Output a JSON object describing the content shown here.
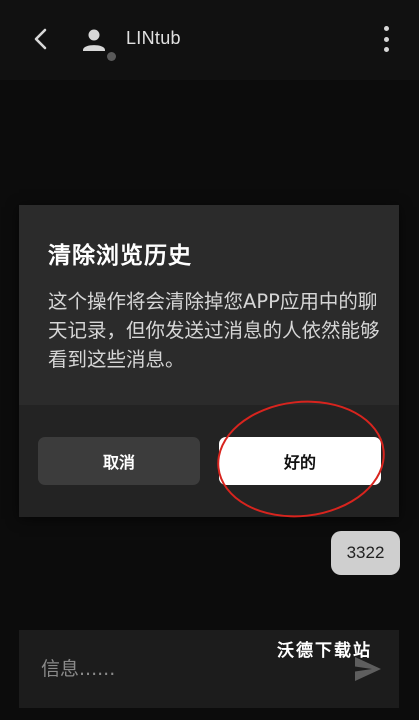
{
  "header": {
    "contact_name": "LINtub",
    "back_icon": "back-arrow-icon",
    "avatar_icon": "person-icon",
    "menu_icon": "more-vertical-icon"
  },
  "dialog": {
    "title": "清除浏览历史",
    "body": "这个操作将会清除掉您APP应用中的聊天记录，但你发送过消息的人依然能够看到这些消息。",
    "cancel_label": "取消",
    "confirm_label": "好的"
  },
  "messages": [
    {
      "text": "3322",
      "direction": "outgoing"
    }
  ],
  "composer": {
    "placeholder": "信息......",
    "send_icon": "send-icon"
  },
  "watermark": "沃德下载站",
  "colors": {
    "background": "#0c0c0c",
    "dialog": "#2b2b2b",
    "confirm_button": "#ffffff",
    "cancel_button": "#3c3c3c",
    "highlight_ring": "#d8241e",
    "bubble": "#cfcfcf"
  }
}
